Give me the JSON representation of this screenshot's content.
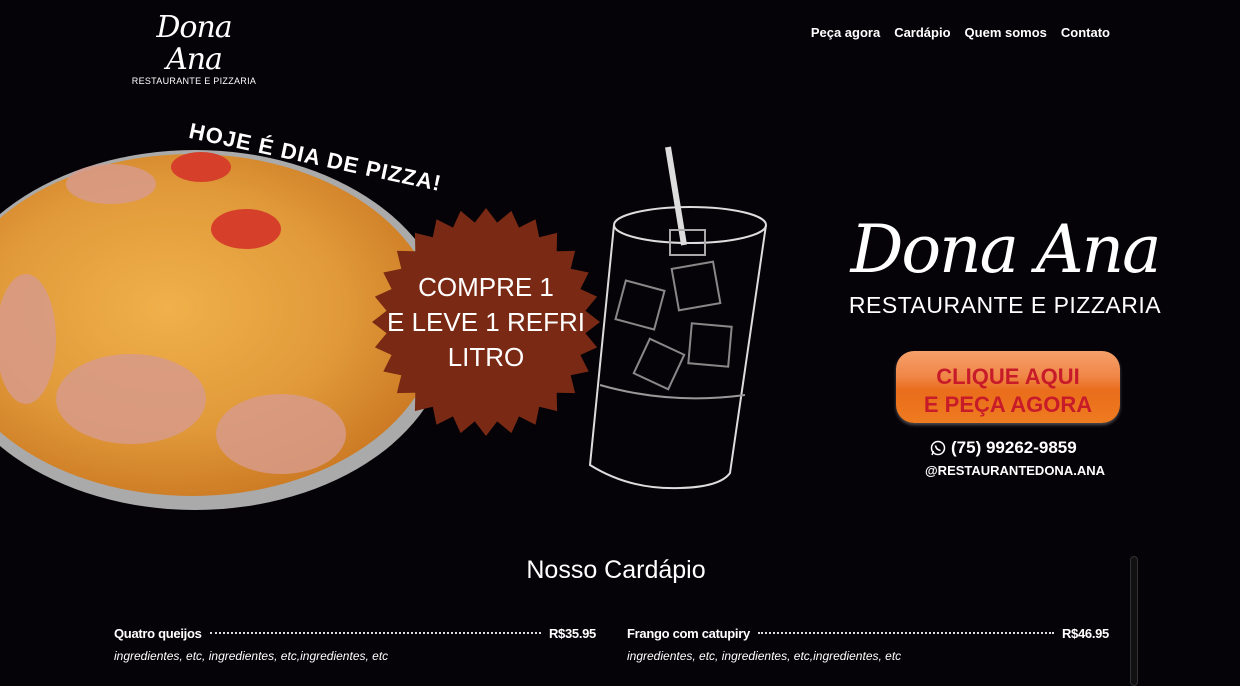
{
  "header": {
    "logo_script": "Dona Ana",
    "logo_sub": "RESTAURANTE E PIZZARIA",
    "nav": [
      {
        "label": "Peça agora"
      },
      {
        "label": "Cardápio"
      },
      {
        "label": "Quem somos"
      },
      {
        "label": "Contato"
      }
    ]
  },
  "hero": {
    "headline": "HOJE É DIA DE PIZZA!",
    "promo_lines": [
      "COMPRE 1",
      "E LEVE 1 REFRI",
      "LITRO"
    ],
    "promo_color": "#7a2a14",
    "brand_script": "Dona Ana",
    "brand_sub": "RESTAURANTE E PIZZARIA",
    "cta_line1": "CLIQUE AQUI",
    "cta_line2": "E PEÇA AGORA",
    "phone": "(75) 99262-9859",
    "instagram": "@RESTAURANTEDONA.ANA"
  },
  "menu": {
    "title": "Nosso Cardápio",
    "items": [
      {
        "name": "Quatro queijos",
        "price": "R$35.95",
        "desc": "ingredientes, etc, ingredientes, etc,ingredientes, etc"
      },
      {
        "name": "Frango com catupiry",
        "price": "R$46.95",
        "desc": "ingredientes, etc, ingredientes, etc,ingredientes, etc"
      }
    ]
  }
}
